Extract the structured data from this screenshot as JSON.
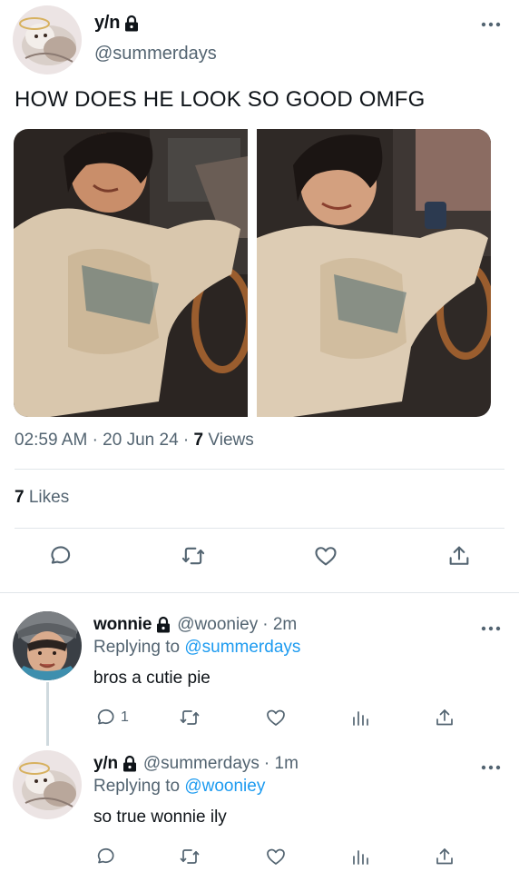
{
  "main_tweet": {
    "display_name": "y/n",
    "handle": "@summerdays",
    "text": "HOW DOES HE LOOK SO GOOD OMFG",
    "time": "02:59 AM",
    "date": "20 Jun 24",
    "views_count": "7",
    "views_label": "Views",
    "likes_count": "7",
    "likes_label": "Likes",
    "separator": "·"
  },
  "replies": [
    {
      "display_name": "wonnie",
      "handle": "@wooniey",
      "time": "· 2m",
      "replying_prefix": "Replying to",
      "replying_to": "@summerdays",
      "text": "bros a cutie pie",
      "reply_count": "1"
    },
    {
      "display_name": "y/n",
      "handle": "@summerdays",
      "time": "· 1m",
      "replying_prefix": "Replying to",
      "replying_to": "@wooniey",
      "text": "so true wonnie ily",
      "reply_count": ""
    }
  ],
  "icons": {
    "more": "more-icon",
    "lock": "lock-icon",
    "reply": "reply-icon",
    "retweet": "retweet-icon",
    "like": "heart-icon",
    "analytics": "analytics-icon",
    "share": "share-icon"
  },
  "colors": {
    "link": "#1d9bf0",
    "secondary_text": "#536471",
    "divider": "#e1e6ea"
  }
}
